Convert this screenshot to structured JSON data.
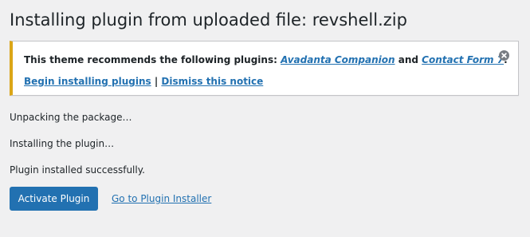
{
  "page": {
    "title": "Installing plugin from uploaded file: revshell.zip"
  },
  "notice": {
    "prefix": "This theme recommends the following plugins: ",
    "plugin1": "Avadanta Companion",
    "conjunction": " and ",
    "plugin2": "Contact Form 7",
    "suffix": ".",
    "begin_installing": "Begin installing plugins",
    "separator": " | ",
    "dismiss_notice": "Dismiss this notice",
    "border_color": "#dba617",
    "dismiss_icon": "close-circle-icon"
  },
  "steps": {
    "unpacking": "Unpacking the package…",
    "installing": "Installing the plugin…",
    "success": "Plugin installed successfully."
  },
  "actions": {
    "activate_label": "Activate Plugin",
    "installer_link": "Go to Plugin Installer"
  },
  "colors": {
    "accent": "#2271b1",
    "background": "#f0f0f1"
  }
}
